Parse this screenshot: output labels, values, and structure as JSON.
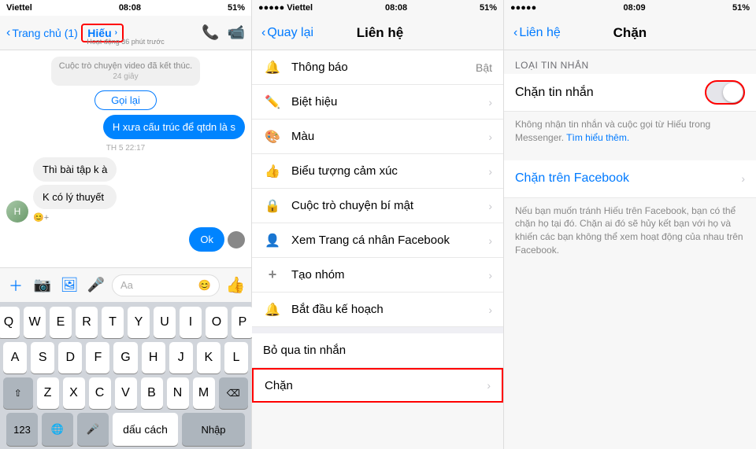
{
  "panel1": {
    "statusBar": {
      "carrier": "Viettel",
      "signal": "●●●●●",
      "time": "08:08",
      "battery": "51%"
    },
    "header": {
      "backLabel": "Trang chủ (1)",
      "contactName": "Hiếu",
      "subtitle": "Hoạt động 36 phút trước",
      "callIcon": "📞",
      "videoIcon": "📹"
    },
    "messages": [
      {
        "type": "system",
        "text": "Cuộc trò chuyện video đã kết thúc."
      },
      {
        "type": "system-small",
        "text": "24 giây"
      },
      {
        "type": "recall",
        "text": "Gọi lại"
      },
      {
        "type": "outgoing",
        "text": "H xưa cấu trúc để qtdn là s"
      },
      {
        "type": "time",
        "text": "TH 5 22:17"
      },
      {
        "type": "incoming",
        "texts": [
          "Thì bài tập k à",
          "K có lý thuyết"
        ],
        "reaction": "😊+"
      },
      {
        "type": "outgoing-ok",
        "text": "Ok"
      }
    ],
    "inputBar": {
      "placeholder": "Aa",
      "addIcon": "+",
      "cameraIcon": "📷",
      "imageIcon": "🖼",
      "micIcon": "🎤",
      "emojiIcon": "😊",
      "likeIcon": "👍"
    },
    "keyboard": {
      "row1": [
        "Q",
        "W",
        "E",
        "R",
        "T",
        "Y",
        "U",
        "I",
        "O",
        "P"
      ],
      "row2": [
        "A",
        "S",
        "D",
        "F",
        "G",
        "H",
        "J",
        "K",
        "L"
      ],
      "row3": [
        "Z",
        "X",
        "C",
        "V",
        "B",
        "N",
        "M"
      ],
      "spaceLabel": "dấu cách",
      "returnLabel": "Nhập",
      "numLabel": "123",
      "deleteLabel": "⌫"
    }
  },
  "panel2": {
    "statusBar": {
      "carrier": "●●●●● Viettel",
      "time": "08:08",
      "battery": "51%"
    },
    "header": {
      "backLabel": "Quay lại",
      "title": "Liên hệ"
    },
    "items": [
      {
        "icon": "🔔",
        "label": "Thông báo",
        "value": "Bật",
        "hasChevron": false
      },
      {
        "icon": "✏️",
        "label": "Biệt hiệu",
        "value": "",
        "hasChevron": true
      },
      {
        "icon": "🎨",
        "label": "Màu",
        "value": "",
        "hasChevron": true
      },
      {
        "icon": "👍",
        "label": "Biểu tượng cảm xúc",
        "value": "",
        "hasChevron": true
      },
      {
        "icon": "🔒",
        "label": "Cuộc trò chuyện bí mật",
        "value": "",
        "hasChevron": true
      },
      {
        "icon": "👤",
        "label": "Xem Trang cá nhân Facebook",
        "value": "",
        "hasChevron": true
      },
      {
        "icon": "+",
        "label": "Tạo nhóm",
        "value": "",
        "hasChevron": true
      },
      {
        "icon": "🔔",
        "label": "Bắt đầu kế hoạch",
        "value": "",
        "hasChevron": true
      }
    ],
    "bottomItems": [
      {
        "label": "Bỏ qua tin nhắn",
        "isRed": false
      },
      {
        "label": "Chặn",
        "isRed": false,
        "isChan": true
      }
    ]
  },
  "panel3": {
    "statusBar": {
      "carrier": "●●●●●",
      "time": "08:09",
      "battery": "51%"
    },
    "header": {
      "backLabel": "Liên hệ",
      "title": "Chặn"
    },
    "sectionTitle": "LOẠI TIN NHẮN",
    "blockMessages": {
      "label": "Chặn tin nhắn",
      "toggleOn": false
    },
    "blockDescription": "Không nhận tin nhắn và cuộc gọi từ Hiếu trong Messenger. ",
    "learnMore": "Tìm hiểu thêm.",
    "blockFacebook": {
      "label": "Chặn trên Facebook"
    },
    "blockFacebookDesc": "Nếu bạn muốn tránh Hiếu trên Facebook, bạn có thể chặn họ tại đó. Chặn ai đó sẽ hủy kết bạn với họ và khiến các bạn không thể xem hoạt động của nhau trên Facebook."
  }
}
